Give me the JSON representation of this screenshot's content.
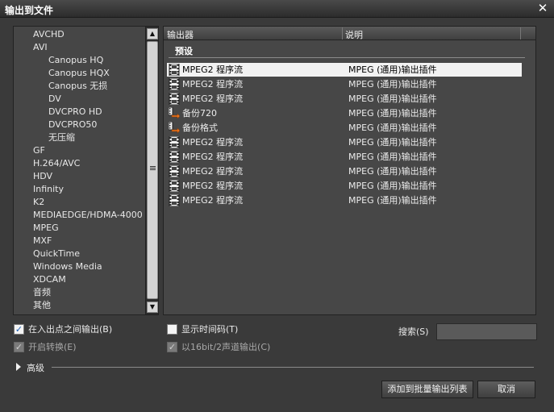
{
  "window": {
    "title": "输出到文件"
  },
  "tree": {
    "items": [
      {
        "label": "AVCHD",
        "level": 1
      },
      {
        "label": "AVI",
        "level": 1
      },
      {
        "label": "Canopus HQ",
        "level": 2
      },
      {
        "label": "Canopus HQX",
        "level": 2
      },
      {
        "label": "Canopus 无损",
        "level": 2
      },
      {
        "label": "DV",
        "level": 2
      },
      {
        "label": "DVCPRO HD",
        "level": 2
      },
      {
        "label": "DVCPRO50",
        "level": 2
      },
      {
        "label": "无压缩",
        "level": 2
      },
      {
        "label": "GF",
        "level": 1
      },
      {
        "label": "H.264/AVC",
        "level": 1
      },
      {
        "label": "HDV",
        "level": 1
      },
      {
        "label": "Infinity",
        "level": 1
      },
      {
        "label": "K2",
        "level": 1
      },
      {
        "label": "MEDIAEDGE/HDMA-4000",
        "level": 1
      },
      {
        "label": "MPEG",
        "level": 1
      },
      {
        "label": "MXF",
        "level": 1
      },
      {
        "label": "QuickTime",
        "level": 1
      },
      {
        "label": "Windows Media",
        "level": 1
      },
      {
        "label": "XDCAM",
        "level": 1
      },
      {
        "label": "音频",
        "level": 1
      },
      {
        "label": "其他",
        "level": 1
      }
    ]
  },
  "list": {
    "columns": {
      "exporter": "输出器",
      "description": "说明"
    },
    "group": "预设",
    "rows": [
      {
        "name": "MPEG2 程序流",
        "desc": "MPEG (通用)输出插件",
        "icon": "film-icon",
        "selected": true
      },
      {
        "name": "MPEG2 程序流",
        "desc": "MPEG (通用)输出插件",
        "icon": "film-icon",
        "selected": false
      },
      {
        "name": "MPEG2 程序流",
        "desc": "MPEG (通用)输出插件",
        "icon": "film-icon",
        "selected": false
      },
      {
        "name": "备份720",
        "desc": "MPEG (通用)输出插件",
        "icon": "film-export-icon",
        "selected": false
      },
      {
        "name": "备份格式",
        "desc": "MPEG (通用)输出插件",
        "icon": "film-export-icon",
        "selected": false
      },
      {
        "name": "MPEG2 程序流",
        "desc": "MPEG (通用)输出插件",
        "icon": "film-icon",
        "selected": false
      },
      {
        "name": "MPEG2 程序流",
        "desc": "MPEG (通用)输出插件",
        "icon": "film-icon",
        "selected": false
      },
      {
        "name": "MPEG2 程序流",
        "desc": "MPEG (通用)输出插件",
        "icon": "film-icon",
        "selected": false
      },
      {
        "name": "MPEG2 程序流",
        "desc": "MPEG (通用)输出插件",
        "icon": "film-icon",
        "selected": false
      },
      {
        "name": "MPEG2 程序流",
        "desc": "MPEG (通用)输出插件",
        "icon": "film-icon",
        "selected": false
      }
    ]
  },
  "options": {
    "in_out": {
      "label": "在入出点之间输出(B)",
      "checked": true,
      "enabled": true
    },
    "timecode": {
      "label": "显示时间码(T)",
      "checked": false,
      "enabled": true
    },
    "convert": {
      "label": "开启转换(E)",
      "checked": true,
      "enabled": false
    },
    "bit16": {
      "label": "以16bit/2声道输出(C)",
      "checked": true,
      "enabled": false
    }
  },
  "search": {
    "label": "搜索(S)",
    "value": ""
  },
  "advanced": {
    "label": "高级"
  },
  "buttons": {
    "add": "添加到批量输出列表",
    "cancel": "取消"
  },
  "colors": {
    "selected_row": "#f2f2f2",
    "panel": "#474747",
    "checkmark": "#1b5fb5"
  }
}
